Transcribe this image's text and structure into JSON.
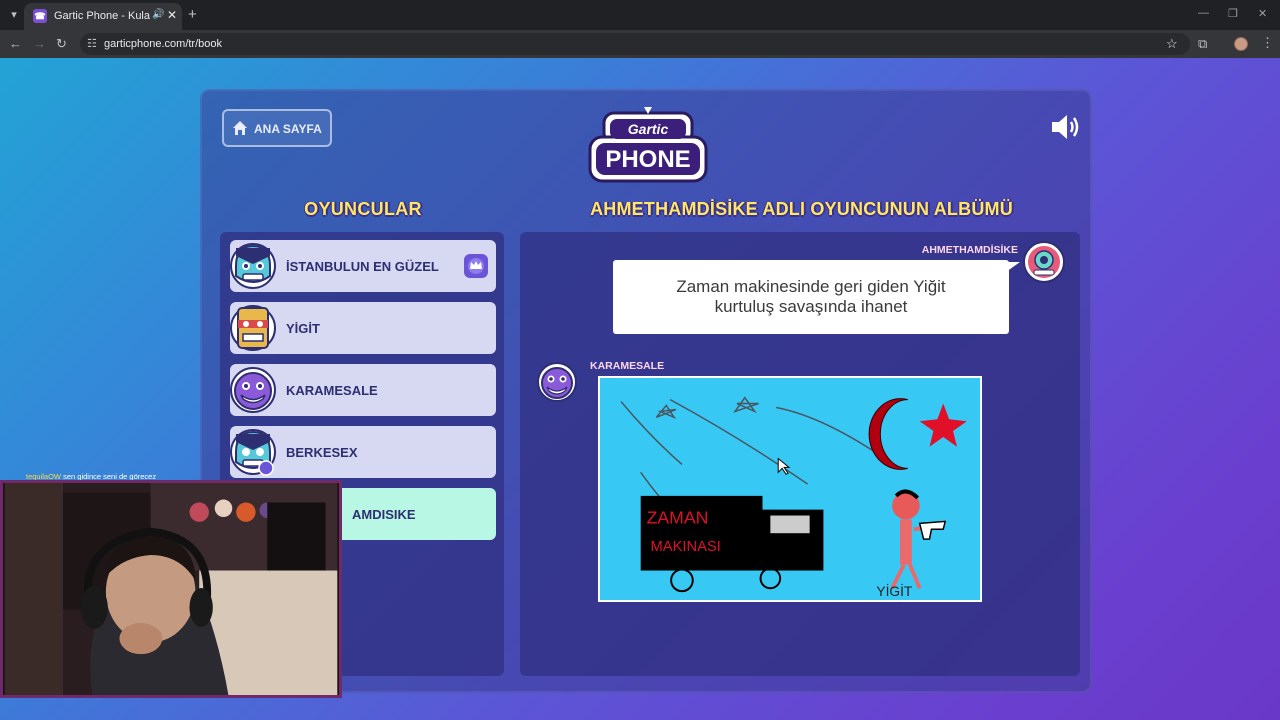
{
  "browser": {
    "tab_title": "Gartic Phone - Kulaktan Ku",
    "url": "garticphone.com/tr/book"
  },
  "header": {
    "home_label": "ANA SAYFA",
    "logo_top": "Gartic",
    "logo_bottom": "PHONE"
  },
  "players": {
    "title": "OYUNCULAR",
    "items": [
      {
        "name": "İSTANBULUN EN GÜZEL"
      },
      {
        "name": "YİGİT"
      },
      {
        "name": "KARAMESALE"
      },
      {
        "name": "BERKESEX"
      },
      {
        "name": "AMDISIKE"
      }
    ]
  },
  "album": {
    "title": "AHMETHAMDİSİKE ADLI OYUNCUNUN ALBÜMÜ",
    "author": "AHMETHAMDİSİKE",
    "prompt_line1": "Zaman makinesinde geri giden Yiğit",
    "prompt_line2": "kurtuluş savaşında ihanet",
    "drawer": "KARAMESALE",
    "drawing_text_1": "ZAMAN",
    "drawing_text_2": "MAKINASI",
    "drawing_text_3": "YİGİT"
  },
  "chat": {
    "user": "tequilaOW",
    "message": "sen gidince seni de görecez"
  },
  "colors": {
    "title_yellow": "#ffe766",
    "player_card": "#d7d9f3",
    "player_active": "#b8f7e4",
    "canvas_bg": "#38c8f4"
  }
}
